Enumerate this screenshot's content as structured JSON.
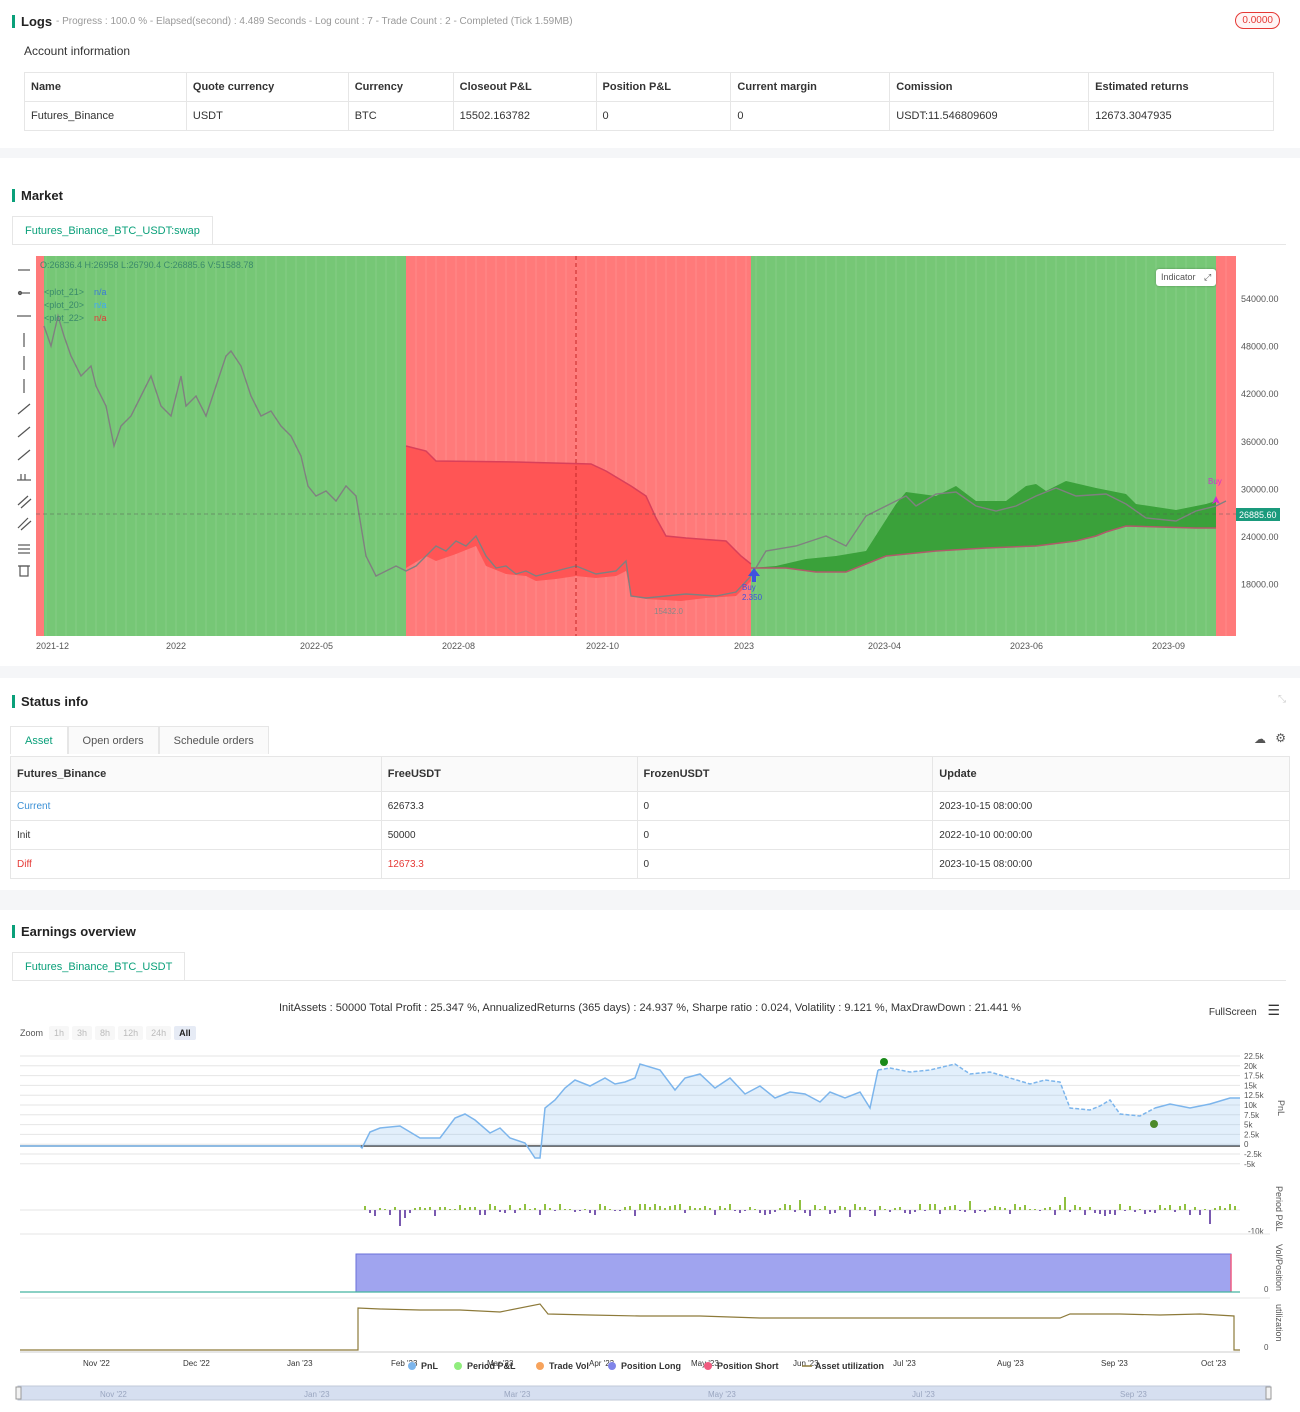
{
  "logs": {
    "title": "Logs",
    "progress_line": "- Progress : 100.0 % - Elapsed(second) : 4.489  Seconds - Log count : 7 - Trade Count : 2 - Completed (Tick 1.59MB)",
    "badge": "0.0000"
  },
  "account": {
    "title": "Account information",
    "headers": [
      "Name",
      "Quote currency",
      "Currency",
      "Closeout P&L",
      "Position P&L",
      "Current margin",
      "Comission",
      "Estimated returns"
    ],
    "row": [
      "Futures_Binance",
      "USDT",
      "BTC",
      "15502.163782",
      "0",
      "0",
      "USDT:11.546809609",
      "12673.3047935"
    ]
  },
  "market": {
    "title": "Market",
    "tab": "Futures_Binance_BTC_USDT:swap",
    "ohlc": "O:26836.4 H:26958 L:26790.4 C:26885.6 V:51588.78",
    "plots": [
      {
        "label": "<plot_21>",
        "value": "n/a",
        "color": "#3a7bd5"
      },
      {
        "label": "<plot_20>",
        "value": "n/a",
        "color": "#3fa9f5"
      },
      {
        "label": "<plot_22>",
        "value": "n/a",
        "color": "#e53935"
      }
    ],
    "indicator_btn": "Indicator",
    "price_tag": "26885.60",
    "y_ticks": [
      "54000.00",
      "48000.00",
      "42000.00",
      "36000.00",
      "30000.00",
      "24000.00",
      "18000.00"
    ],
    "x_ticks": [
      "2021-12",
      "2022",
      "2022-05",
      "2022-08",
      "2022-10",
      "2023",
      "2023-04",
      "2023-06",
      "2023-09"
    ],
    "buy_label": "Buy",
    "buy_value": "2.350",
    "low_label": "15432.0",
    "colors": {
      "green_bg": "#76c776",
      "red_bg": "#ff7a7a",
      "green_fill": "#3aa13a",
      "red_fill": "#ff5555"
    }
  },
  "status": {
    "title": "Status info",
    "tabs": [
      "Asset",
      "Open orders",
      "Schedule orders"
    ],
    "headers": [
      "Futures_Binance",
      "FreeUSDT",
      "FrozenUSDT",
      "Update"
    ],
    "rows": [
      [
        "Current",
        "62673.3",
        "0",
        "2023-10-15 08:00:00"
      ],
      [
        "Init",
        "50000",
        "0",
        "2022-10-10 00:00:00"
      ],
      [
        "Diff",
        "12673.3",
        "0",
        "2023-10-15 08:00:00"
      ]
    ]
  },
  "earnings": {
    "title": "Earnings overview",
    "tab": "Futures_Binance_BTC_USDT",
    "summary": "InitAssets : 50000 Total Profit : 25.347 %, AnnualizedReturns (365 days) : 24.937 %, Sharpe ratio : 0.024, Volatility : 9.121 %, MaxDrawDown : 21.441 %",
    "fullscreen": "FullScreen",
    "zoom_label": "Zoom",
    "zoom_opts": [
      "1h",
      "3h",
      "8h",
      "12h",
      "24h",
      "All"
    ],
    "pnl_ticks": [
      "22.5k",
      "20k",
      "17.5k",
      "15k",
      "12.5k",
      "10k",
      "7.5k",
      "5k",
      "2.5k",
      "0",
      "-2.5k",
      "-5k"
    ],
    "pnl_axis": "PnL",
    "period_axis": "Period P&L",
    "period_tick": "-10k",
    "vol_axis": "Vol/Position",
    "vol_tick": "0",
    "util_axis": "utilization",
    "util_tick": "0",
    "x_ticks": [
      "Nov '22",
      "Dec '22",
      "Jan '23",
      "Feb '23",
      "Mar '23",
      "Apr '23",
      "May '23",
      "Jun '23",
      "Jul '23",
      "Aug '23",
      "Sep '23",
      "Oct '23"
    ],
    "nav_ticks": [
      "Nov '22",
      "Jan '23",
      "Mar '23",
      "May '23",
      "Jul '23",
      "Sep '23"
    ],
    "legend": [
      {
        "label": "PnL",
        "color": "#7cb5ec"
      },
      {
        "label": "Period P&L",
        "color": "#90ed7d"
      },
      {
        "label": "Trade Vol",
        "color": "#f7a35c"
      },
      {
        "label": "Position Long",
        "color": "#8085e9"
      },
      {
        "label": "Position Short",
        "color": "#f15c80"
      },
      {
        "label": "Asset utilization",
        "color": "#8d7a3a"
      }
    ]
  }
}
